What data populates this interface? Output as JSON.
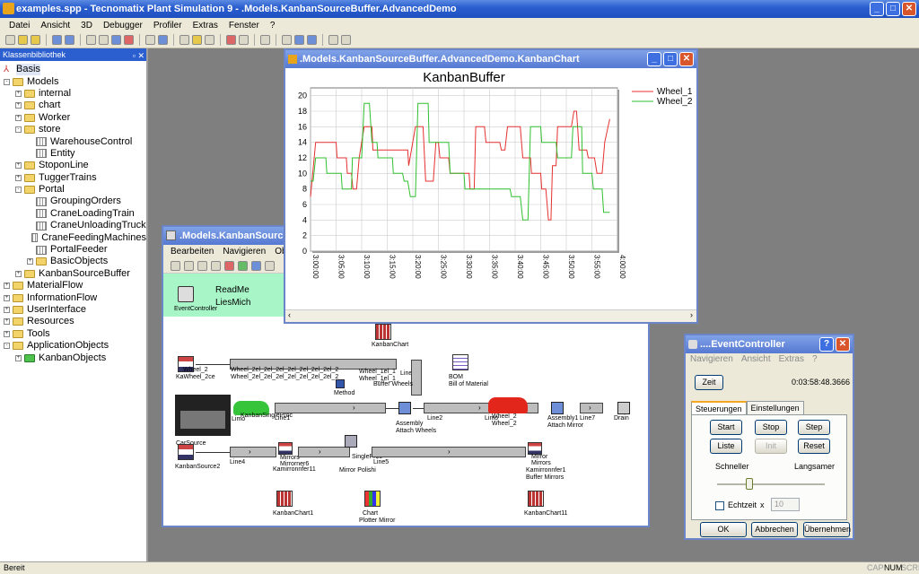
{
  "app": {
    "title": "examples.spp - Tecnomatix Plant Simulation 9 - .Models.KanbanSourceBuffer.AdvancedDemo",
    "menu": [
      "Datei",
      "Ansicht",
      "3D",
      "Debugger",
      "Profiler",
      "Extras",
      "Fenster",
      "?"
    ]
  },
  "classlib": {
    "header": "Klassenbibliothek",
    "nodes": [
      {
        "label": "Basis",
        "level": 0,
        "type": "basis"
      },
      {
        "label": "Models",
        "level": 0,
        "type": "folder",
        "pm": "-"
      },
      {
        "label": "internal",
        "level": 1,
        "type": "folder",
        "pm": "+"
      },
      {
        "label": "chart",
        "level": 1,
        "type": "folder",
        "pm": "+"
      },
      {
        "label": "Worker",
        "level": 1,
        "type": "folder",
        "pm": "+"
      },
      {
        "label": "store",
        "level": 1,
        "type": "folder",
        "pm": "-"
      },
      {
        "label": "WarehouseControl",
        "level": 2,
        "type": "obj"
      },
      {
        "label": "Entity",
        "level": 2,
        "type": "obj"
      },
      {
        "label": "StoponLine",
        "level": 1,
        "type": "folder",
        "pm": "+"
      },
      {
        "label": "TuggerTrains",
        "level": 1,
        "type": "folder",
        "pm": "+"
      },
      {
        "label": "Portal",
        "level": 1,
        "type": "folder",
        "pm": "-"
      },
      {
        "label": "GroupingOrders",
        "level": 2,
        "type": "obj"
      },
      {
        "label": "CraneLoadingTrain",
        "level": 2,
        "type": "obj"
      },
      {
        "label": "CraneUnloadingTruck",
        "level": 2,
        "type": "obj"
      },
      {
        "label": "CraneFeedingMachines",
        "level": 2,
        "type": "obj"
      },
      {
        "label": "PortalFeeder",
        "level": 2,
        "type": "obj"
      },
      {
        "label": "BasicObjects",
        "level": 2,
        "type": "folder",
        "pm": "+"
      },
      {
        "label": "KanbanSourceBuffer",
        "level": 1,
        "type": "folder",
        "pm": "+"
      },
      {
        "label": "MaterialFlow",
        "level": 0,
        "type": "folder",
        "pm": "+"
      },
      {
        "label": "InformationFlow",
        "level": 0,
        "type": "folder",
        "pm": "+"
      },
      {
        "label": "UserInterface",
        "level": 0,
        "type": "folder",
        "pm": "+"
      },
      {
        "label": "Resources",
        "level": 0,
        "type": "folder",
        "pm": "+"
      },
      {
        "label": "Tools",
        "level": 0,
        "type": "folder",
        "pm": "+"
      },
      {
        "label": "ApplicationObjects",
        "level": 0,
        "type": "folder",
        "pm": "-"
      },
      {
        "label": "KanbanObjects",
        "level": 1,
        "type": "folder",
        "pm": "+",
        "green": true
      }
    ]
  },
  "status": {
    "text": "Bereit",
    "cap": "CAP",
    "num": "NUM",
    "scrl": "SCRL"
  },
  "network": {
    "title": ".Models.KanbanSourceBuff",
    "menu": [
      "Bearbeiten",
      "Navigieren",
      "Objekte"
    ],
    "readme": "ReadMe",
    "liesmich": "LiesMich",
    "event_controller": "EventController",
    "labels": {
      "kanbanchart": "KanbanChart",
      "kawheel": "KaWheel_2ce",
      "wheel2": "Wheel_2",
      "wheelbuf": "Wheel_2el_2el_2el_2el_2el_2el_2el_2",
      "wheelbuf2": "Wheel_2el_2el_2el_2el_2el_2el_2el_2",
      "wheel1": "Wheel_1el_1",
      "wheel1b": "Wheel_1el_1",
      "line3": "Line3",
      "bufferwheels": "Buffer Wheels",
      "method": "Method",
      "bom": "BOM",
      "bom2": "Bill of Material",
      "carsource": "CarSource",
      "limo": "Limo",
      "kanbansingleproc": "KanbanSingleProc",
      "line1": "Line1",
      "assembly": "Assembly",
      "attachwheels": "Attach Wheels",
      "line2": "Line2",
      "limo2": "Limo",
      "wheel2a": "Wheel_2",
      "wheel2b": "Wheel_2",
      "assembly1": "Assembly1",
      "attachmirror": "Attach Mirror",
      "line7": "Line7",
      "drain": "Drain",
      "kanbansource2": "KanbanSource2",
      "line4": "Line4",
      "mirrors": "Mirrors",
      "mirrorner6": "Mirrorner6",
      "kamirror": "Kamirronnfer11",
      "singleproc": "SingleProc",
      "mirrorpolish": "Mirror Polishi",
      "line5": "Line5",
      "mirror2": "Mirror",
      "mirrors2": "Mirrors",
      "kamirror2": "Kamirronnfer1",
      "buffermirrors": "Buffer Mirrors",
      "kanbanchart1": "KanbanChart1",
      "chart": "Chart",
      "plottermirror": "Plotter Mirror",
      "kanbanchart11": "KanbanChart11"
    }
  },
  "chartwin": {
    "title": ".Models.KanbanSourceBuffer.AdvancedDemo.KanbanChart"
  },
  "chart_data": {
    "type": "line",
    "title": "KanbanBuffer",
    "xlabel": "",
    "ylabel": "",
    "ylim": [
      0,
      21
    ],
    "yticks": [
      0,
      2,
      4,
      6,
      8,
      10,
      12,
      14,
      16,
      18,
      20
    ],
    "xlim": [
      180,
      240
    ],
    "xticks": [
      "3:00:00",
      "3:05:00",
      "3:10:00",
      "3:15:00",
      "3:20:00",
      "3:25:00",
      "3:30:00",
      "3:35:00",
      "3:40:00",
      "3:45:00",
      "3:50:00",
      "3:55:00",
      "4:00:00"
    ],
    "legend_position": "top-right",
    "grid": true,
    "series": [
      {
        "name": "Wheel_1",
        "color": "#e63030",
        "x": [
          180,
          181,
          181.5,
          185,
          185.2,
          187,
          187.2,
          188,
          188.3,
          189,
          189.5,
          190.5,
          191,
          192,
          192.2,
          199,
          199.2,
          200.5,
          201,
          202,
          202.5,
          204,
          204.5,
          205,
          205.3,
          207,
          207.3,
          211,
          211.2,
          212,
          212.3,
          214,
          214.3,
          217,
          217.3,
          218,
          218.5,
          221,
          221.5,
          223,
          223.2,
          225,
          225.2,
          226,
          226.5,
          227,
          227.3,
          228,
          228.3,
          231,
          231.5,
          232,
          232.5,
          234,
          234.3,
          235.5,
          236,
          237,
          237.5,
          238.5
        ],
        "y": [
          7,
          14,
          14,
          14,
          12,
          12,
          10,
          10,
          8,
          8,
          12,
          16,
          16,
          16,
          13,
          13,
          11,
          16,
          16,
          16,
          9,
          9,
          14,
          14,
          12,
          12,
          10,
          10,
          8,
          8,
          16,
          16,
          14,
          14,
          13,
          13,
          16,
          16,
          12,
          12,
          10,
          10,
          8,
          8,
          4,
          4,
          11,
          11,
          16,
          16,
          18,
          18,
          13,
          13,
          12,
          12,
          10,
          10,
          14,
          17
        ]
      },
      {
        "name": "Wheel_2",
        "color": "#30c030",
        "x": [
          180,
          180.5,
          181,
          183,
          183.2,
          186,
          186.2,
          188,
          188.2,
          190,
          190.5,
          191.5,
          192,
          193,
          193.2,
          196,
          196.2,
          198,
          198.3,
          199,
          199.5,
          200.5,
          201,
          203,
          203.2,
          207,
          207.3,
          210,
          210.2,
          213,
          213.2,
          215,
          215.3,
          218,
          218.3,
          219,
          219.3,
          221,
          221.5,
          222.5,
          223,
          225,
          225.2,
          228,
          228.3,
          231,
          231.3,
          233,
          233.2,
          235,
          235.3,
          237,
          237.3,
          238.5
        ],
        "y": [
          9,
          9,
          12,
          12,
          10,
          10,
          8,
          8,
          12,
          12,
          19,
          19,
          14,
          14,
          12,
          12,
          10,
          10,
          9,
          9,
          7,
          7,
          19,
          19,
          14,
          14,
          10,
          10,
          8,
          8,
          8,
          8,
          8,
          8,
          8,
          8,
          7,
          7,
          4,
          4,
          16,
          16,
          14,
          14,
          12,
          12,
          16,
          16,
          10,
          10,
          8,
          8,
          5,
          5
        ]
      }
    ]
  },
  "evwin": {
    "title": "....EventController",
    "menu": [
      "Navigieren",
      "Ansicht",
      "Extras",
      "?"
    ],
    "zeit_label": "Zeit",
    "zeit_value": "0:03:58:48.3666",
    "tabs": [
      "Steuerungen",
      "Einstellungen"
    ],
    "start": "Start",
    "stop": "Stop",
    "step": "Step",
    "liste": "Liste",
    "init": "Init",
    "reset": "Reset",
    "schneller": "Schneller",
    "langsamer": "Langsamer",
    "slider_level": 0.3,
    "echtzeit": "Echtzeit",
    "x": "x",
    "echtzeit_value": "10",
    "ok": "OK",
    "abbrechen": "Abbrechen",
    "uebernehmen": "Übernehmen"
  }
}
